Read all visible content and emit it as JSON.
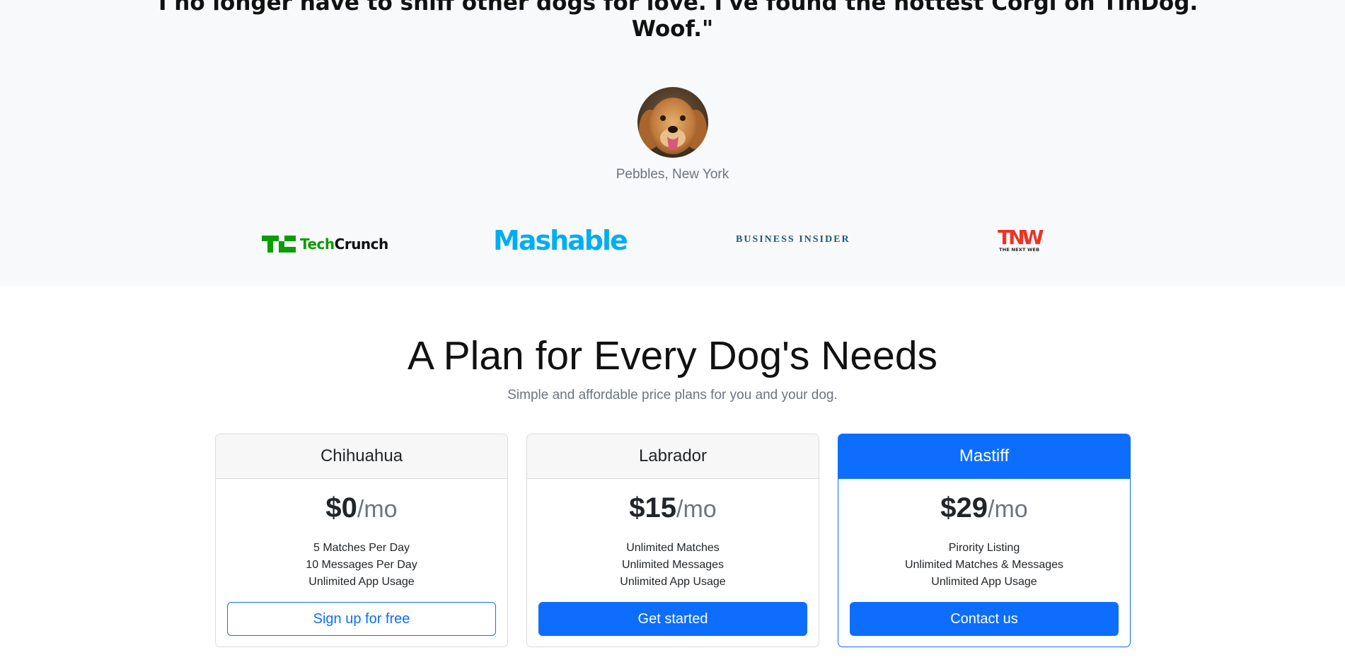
{
  "testimonial": {
    "quote": "\"I no longer have to sniff other dogs for love. I've found the hottest Corgi on TinDog. Woof.\"",
    "author": "Pebbles, New York"
  },
  "press_logos": {
    "techcrunch": {
      "tech": "Tech",
      "crunch": "Crunch"
    },
    "mashable": "Mashable",
    "business_insider": "BUSINESS INSIDER",
    "tnw": {
      "big": "TNW",
      "small": "THE NEXT WEB"
    }
  },
  "pricing": {
    "title": "A Plan for Every Dog's Needs",
    "subtitle": "Simple and affordable price plans for you and your dog.",
    "plans": [
      {
        "name": "Chihuahua",
        "price": "$0",
        "period": "/mo",
        "features": [
          "5 Matches Per Day",
          "10 Messages Per Day",
          "Unlimited App Usage"
        ],
        "button": "Sign up for free"
      },
      {
        "name": "Labrador",
        "price": "$15",
        "period": "/mo",
        "features": [
          "Unlimited Matches",
          "Unlimited Messages",
          "Unlimited App Usage"
        ],
        "button": "Get started"
      },
      {
        "name": "Mastiff",
        "price": "$29",
        "period": "/mo",
        "features": [
          "Pirority Listing",
          "Unlimited Matches & Messages",
          "Unlimited App Usage"
        ],
        "button": "Contact us"
      }
    ]
  },
  "colors": {
    "primary": "#0d6efd",
    "band_bg": "#f8f9fa",
    "muted_text": "#6c757d",
    "techcrunch_green": "#0a9e01",
    "mashable_blue": "#00aeef",
    "business_insider_blue": "#1e5a7a",
    "tnw_red": "#ee3322"
  }
}
